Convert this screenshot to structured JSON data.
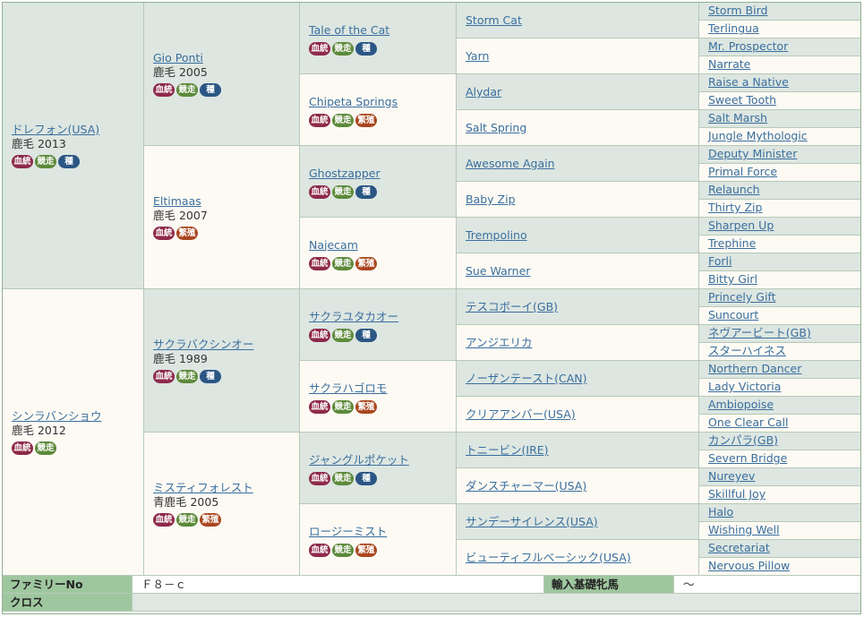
{
  "badge_labels": {
    "blood": "血統",
    "race": "競走",
    "stud": "種",
    "breed": "繁殖"
  },
  "g1": [
    {
      "name": "ドレフォン(USA)",
      "desc": "鹿毛 2013",
      "badges": [
        "blood",
        "race",
        "stud"
      ]
    },
    {
      "name": "シンラバンショウ",
      "desc": "鹿毛 2012",
      "badges": [
        "blood",
        "race"
      ]
    }
  ],
  "g2": [
    {
      "name": "Gio Ponti",
      "desc": "鹿毛 2005",
      "badges": [
        "blood",
        "race",
        "stud"
      ]
    },
    {
      "name": "Eltimaas",
      "desc": "鹿毛 2007",
      "badges": [
        "blood",
        "breed"
      ]
    },
    {
      "name": "サクラバクシンオー",
      "desc": "鹿毛 1989",
      "badges": [
        "blood",
        "race",
        "stud"
      ]
    },
    {
      "name": "ミスティフォレスト",
      "desc": "青鹿毛 2005",
      "badges": [
        "blood",
        "race",
        "breed"
      ]
    }
  ],
  "g3": [
    {
      "name": "Tale of the Cat",
      "badges": [
        "blood",
        "race",
        "stud"
      ]
    },
    {
      "name": "Chipeta Springs",
      "badges": [
        "blood",
        "race",
        "breed"
      ]
    },
    {
      "name": "Ghostzapper",
      "badges": [
        "blood",
        "race",
        "stud"
      ]
    },
    {
      "name": "Najecam",
      "badges": [
        "blood",
        "race",
        "breed"
      ]
    },
    {
      "name": "サクラユタカオー",
      "badges": [
        "blood",
        "race",
        "stud"
      ]
    },
    {
      "name": "サクラハゴロモ",
      "badges": [
        "blood",
        "race",
        "breed"
      ]
    },
    {
      "name": "ジャングルポケット",
      "badges": [
        "blood",
        "race",
        "stud"
      ]
    },
    {
      "name": "ロージーミスト",
      "badges": [
        "blood",
        "race",
        "breed"
      ]
    }
  ],
  "g4": [
    "Storm Cat",
    "Yarn",
    "Alydar",
    "Salt Spring",
    "Awesome Again",
    "Baby Zip",
    "Trempolino",
    "Sue Warner",
    "テスコボーイ(GB)",
    "アンジエリカ",
    "ノーザンテースト(CAN)",
    "クリアアンバー(USA)",
    "トニービン(IRE)",
    "ダンスチャーマー(USA)",
    "サンデーサイレンス(USA)",
    "ビューティフルベーシック(USA)"
  ],
  "g5": [
    "Storm Bird",
    "Terlingua",
    "Mr. Prospector",
    "Narrate",
    "Raise a Native",
    "Sweet Tooth",
    "Salt Marsh",
    "Jungle Mythologic",
    "Deputy Minister",
    "Primal Force",
    "Relaunch",
    "Thirty Zip",
    "Sharpen Up",
    "Trephine",
    "Forli",
    "Bitty Girl",
    "Princely Gift",
    "Suncourt",
    "ネヴアービート(GB)",
    "スターハイネス",
    "Northern Dancer",
    "Lady Victoria",
    "Ambiopoise",
    "One Clear Call",
    "カンパラ(GB)",
    "Severn Bridge",
    "Nureyev",
    "Skillful Joy",
    "Halo",
    "Wishing Well",
    "Secretariat",
    "Nervous Pillow"
  ],
  "footer": {
    "family_label": "ファミリーNo",
    "family_value": "Ｆ８－ｃ",
    "import_label": "輸入基礎牝馬",
    "import_value": "～",
    "cross_label": "クロス",
    "cross_value": ""
  }
}
